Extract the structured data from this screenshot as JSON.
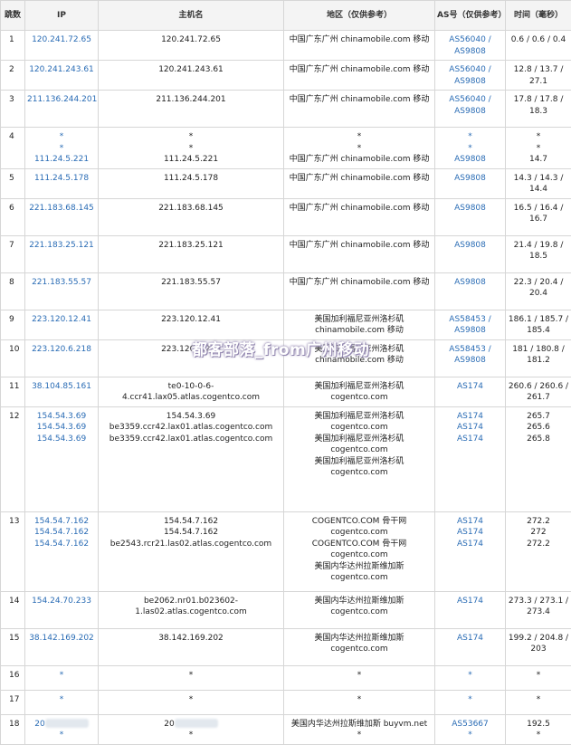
{
  "headers": {
    "hop": "跳数",
    "ip": "IP",
    "host": "主机名",
    "region": "地区（仅供参考）",
    "as": "AS号（仅供参考）",
    "time": "时间（毫秒）"
  },
  "rows": [
    {
      "hop": "1",
      "ip": [
        "120.241.72.65"
      ],
      "host": [
        "120.241.72.65"
      ],
      "region": [
        "中国广东广州 chinamobile.com 移动"
      ],
      "as": [
        "AS56040 /",
        "AS9808"
      ],
      "time": [
        "0.6 / 0.6 / 0.4"
      ]
    },
    {
      "hop": "2",
      "ip": [
        "120.241.243.61"
      ],
      "host": [
        "120.241.243.61"
      ],
      "region": [
        "中国广东广州 chinamobile.com 移动"
      ],
      "as": [
        "AS56040 /",
        "AS9808"
      ],
      "time": [
        "12.8 / 13.7 /",
        "27.1"
      ]
    },
    {
      "hop": "3",
      "ip": [
        "211.136.244.201"
      ],
      "host": [
        "211.136.244.201"
      ],
      "region": [
        "中国广东广州 chinamobile.com 移动"
      ],
      "as": [
        "AS56040 /",
        "AS9808"
      ],
      "time": [
        "17.8 / 17.8 /",
        "18.3"
      ]
    },
    {
      "hop": "4",
      "ip": [
        "*",
        "*",
        "111.24.5.221"
      ],
      "host": [
        "*",
        "*",
        "111.24.5.221"
      ],
      "region": [
        "*",
        "*",
        "中国广东广州 chinamobile.com 移动"
      ],
      "as": [
        "*",
        "*",
        "AS9808"
      ],
      "time": [
        "*",
        "*",
        "14.7"
      ]
    },
    {
      "hop": "5",
      "ip": [
        "111.24.5.178"
      ],
      "host": [
        "111.24.5.178"
      ],
      "region": [
        "中国广东广州 chinamobile.com 移动"
      ],
      "as": [
        "AS9808"
      ],
      "time": [
        "14.3 / 14.3 /",
        "14.4"
      ]
    },
    {
      "hop": "6",
      "ip": [
        "221.183.68.145"
      ],
      "host": [
        "221.183.68.145"
      ],
      "region": [
        "中国广东广州 chinamobile.com 移动"
      ],
      "as": [
        "AS9808"
      ],
      "time": [
        "16.5 / 16.4 /",
        "16.7"
      ]
    },
    {
      "hop": "7",
      "ip": [
        "221.183.25.121"
      ],
      "host": [
        "221.183.25.121"
      ],
      "region": [
        "中国广东广州 chinamobile.com 移动"
      ],
      "as": [
        "AS9808"
      ],
      "time": [
        "21.4 / 19.8 /",
        "18.5"
      ]
    },
    {
      "hop": "8",
      "ip": [
        "221.183.55.57"
      ],
      "host": [
        "221.183.55.57"
      ],
      "region": [
        "中国广东广州 chinamobile.com 移动"
      ],
      "as": [
        "AS9808"
      ],
      "time": [
        "22.3 / 20.4 /",
        "20.4"
      ]
    },
    {
      "hop": "9",
      "ip": [
        "223.120.12.41"
      ],
      "host": [
        "223.120.12.41"
      ],
      "region": [
        "美国加利福尼亚州洛杉矶",
        "chinamobile.com 移动"
      ],
      "as": [
        "AS58453 /",
        "AS9808"
      ],
      "time": [
        "186.1 / 185.7 /",
        "185.4"
      ]
    },
    {
      "hop": "10",
      "ip": [
        "223.120.6.218"
      ],
      "host": [
        "223.120.6.218"
      ],
      "region": [
        "美国加利福尼亚州洛杉矶",
        "chinamobile.com 移动"
      ],
      "as": [
        "AS58453 /",
        "AS9808"
      ],
      "time": [
        "181 / 180.8 /",
        "181.2"
      ]
    },
    {
      "hop": "11",
      "ip": [
        "38.104.85.161"
      ],
      "host": [
        "te0-10-0-6-4.ccr41.lax05.atlas.cogentco.com"
      ],
      "region": [
        "美国加利福尼亚州洛杉矶",
        "cogentco.com"
      ],
      "as": [
        "AS174"
      ],
      "time": [
        "260.6 / 260.6 /",
        "261.7"
      ]
    },
    {
      "hop": "12",
      "ip": [
        "154.54.3.69",
        "154.54.3.69",
        "154.54.3.69"
      ],
      "host": [
        "154.54.3.69",
        "be3359.ccr42.lax01.atlas.cogentco.com",
        "be3359.ccr42.lax01.atlas.cogentco.com"
      ],
      "region": [
        "美国加利福尼亚州洛杉矶",
        "cogentco.com",
        "美国加利福尼亚州洛杉矶",
        "cogentco.com",
        "美国加利福尼亚州洛杉矶",
        "cogentco.com"
      ],
      "as": [
        "AS174",
        "AS174",
        "AS174"
      ],
      "time": [
        "265.7",
        "265.6",
        "265.8"
      ]
    },
    {
      "hop": "13",
      "ip": [
        "154.54.7.162",
        "154.54.7.162",
        "154.54.7.162"
      ],
      "host": [
        "154.54.7.162",
        "154.54.7.162",
        "be2543.rcr21.las02.atlas.cogentco.com"
      ],
      "region": [
        "COGENTCO.COM 骨干网",
        "cogentco.com",
        "COGENTCO.COM 骨干网",
        "cogentco.com",
        "美国内华达州拉斯维加斯",
        "cogentco.com"
      ],
      "as": [
        "AS174",
        "AS174",
        "AS174"
      ],
      "time": [
        "272.2",
        "272",
        "272.2"
      ]
    },
    {
      "hop": "14",
      "ip": [
        "154.24.70.233"
      ],
      "host": [
        "be2062.nr01.b023602-",
        "1.las02.atlas.cogentco.com"
      ],
      "region": [
        "美国内华达州拉斯维加斯",
        "cogentco.com"
      ],
      "as": [
        "AS174"
      ],
      "time": [
        "273.3 / 273.1 /",
        "273.4"
      ]
    },
    {
      "hop": "15",
      "ip": [
        "38.142.169.202"
      ],
      "host": [
        "38.142.169.202"
      ],
      "region": [
        "美国内华达州拉斯维加斯",
        "cogentco.com"
      ],
      "as": [
        "AS174"
      ],
      "time": [
        "199.2 / 204.8 /",
        "203"
      ]
    },
    {
      "hop": "16",
      "ip": [
        "*"
      ],
      "host": [
        "*"
      ],
      "region": [
        "*"
      ],
      "as": [
        "*"
      ],
      "time": [
        "*"
      ]
    },
    {
      "hop": "17",
      "ip": [
        "*"
      ],
      "host": [
        "*"
      ],
      "region": [
        "*"
      ],
      "as": [
        "*"
      ],
      "time": [
        "*"
      ]
    },
    {
      "hop": "18",
      "ip": [
        "20",
        "*"
      ],
      "host": [
        "20",
        "*"
      ],
      "region": [
        "美国内华达州拉斯维加斯 buyvm.net",
        "*"
      ],
      "as": [
        "AS53667",
        "*"
      ],
      "time": [
        "192.5",
        "*"
      ]
    }
  ],
  "watermark": "都客部落_from广州移动"
}
